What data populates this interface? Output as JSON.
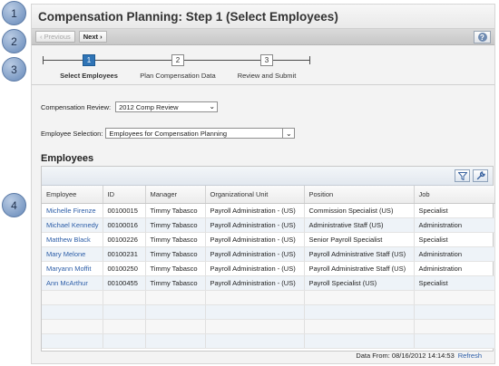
{
  "callouts": [
    "1",
    "2",
    "3",
    "4"
  ],
  "title": "Compensation Planning: Step 1 (Select Employees)",
  "toolbar": {
    "previous_label": "‹ Previous",
    "next_label": "Next ›",
    "help_glyph": "?"
  },
  "wizard": {
    "steps": [
      {
        "number": "1",
        "label": "Select Employees",
        "active": true
      },
      {
        "number": "2",
        "label": "Plan Compensation Data",
        "active": false
      },
      {
        "number": "3",
        "label": "Review and Submit",
        "active": false
      }
    ]
  },
  "form": {
    "review_label": "Compensation Review:",
    "review_value": "2012 Comp Review",
    "selection_label": "Employee Selection:",
    "selection_value": "Employees for Compensation Planning"
  },
  "employees": {
    "heading": "Employees",
    "tools": {
      "filter_icon": "filter-icon",
      "settings_icon": "wrench-icon"
    },
    "columns": [
      "Employee",
      "ID",
      "Manager",
      "Organizational Unit",
      "Position",
      "Job"
    ],
    "rows": [
      [
        "Michelle Firenze",
        "00100015",
        "Timmy Tabasco",
        "Payroll Administration - (US)",
        "Commission Specialist (US)",
        "Specialist"
      ],
      [
        "Michael Kennedy",
        "00100016",
        "Timmy Tabasco",
        "Payroll Administration - (US)",
        "Administrative Staff (US)",
        "Administration"
      ],
      [
        "Matthew Black",
        "00100226",
        "Timmy Tabasco",
        "Payroll Administration - (US)",
        "Senior Payroll Specialist",
        "Specialist"
      ],
      [
        "Mary Melone",
        "00100231",
        "Timmy Tabasco",
        "Payroll Administration - (US)",
        "Payroll Administrative Staff (US)",
        "Administration"
      ],
      [
        "Maryann Moffit",
        "00100250",
        "Timmy Tabasco",
        "Payroll Administration - (US)",
        "Payroll Administrative Staff (US)",
        "Administration"
      ],
      [
        "Ann McArthur",
        "00100455",
        "Timmy Tabasco",
        "Payroll Administration - (US)",
        "Payroll Specialist (US)",
        "Specialist"
      ]
    ]
  },
  "footer": {
    "data_from": "Data From: 08/16/2012 14:14:53",
    "refresh_label": "Refresh"
  }
}
